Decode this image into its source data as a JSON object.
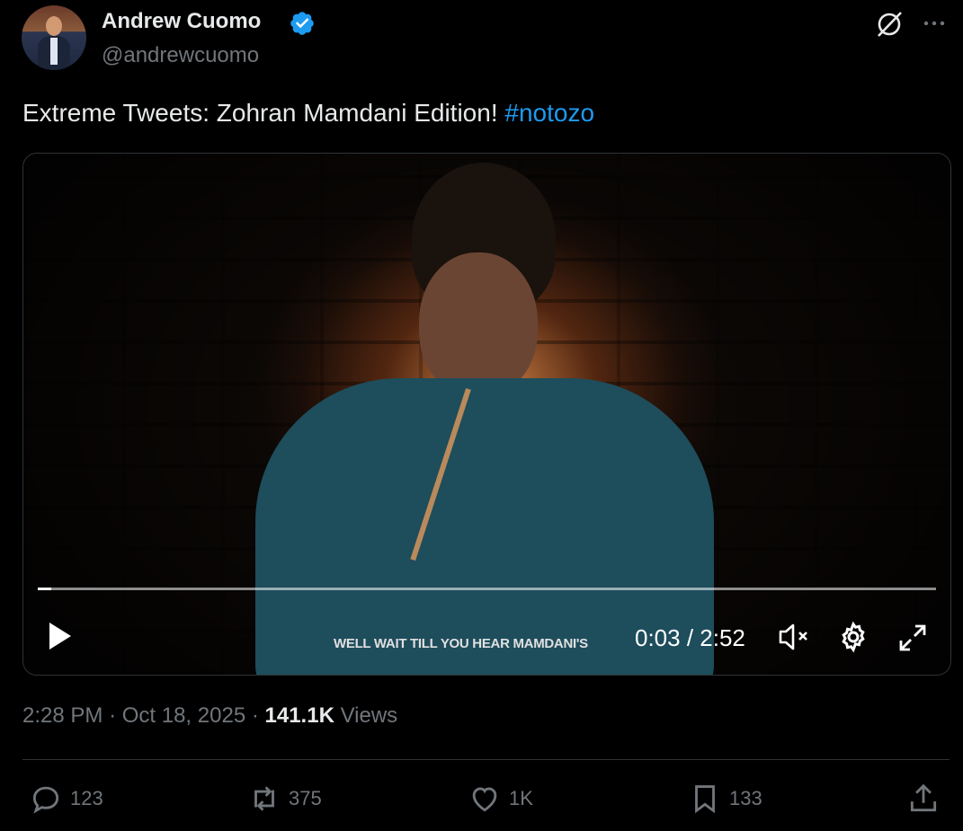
{
  "author": {
    "name": "Andrew Cuomo",
    "handle": "@andrewcuomo",
    "verified_icon": "verified-badge-icon"
  },
  "header_icons": [
    "grok-icon",
    "more-icon"
  ],
  "tweet": {
    "text": "Extreme Tweets: Zohran Mamdani Edition!",
    "hashtag": "#notozo"
  },
  "video": {
    "caption": "WELL WAIT TILL YOU HEAR MAMDANI'S",
    "time": "0:03 / 2:52",
    "progress_fraction": 0.015,
    "controls": [
      "play-icon",
      "mute-icon",
      "settings-icon",
      "fullscreen-icon"
    ]
  },
  "meta": {
    "time": "2:28 PM",
    "date": "Oct 18, 2025",
    "views_count": "141.1K",
    "views_label": "Views"
  },
  "actions": {
    "replies": "123",
    "reposts": "375",
    "likes": "1K",
    "bookmarks": "133"
  },
  "colors": {
    "accent": "#1d9bf0",
    "muted": "#71767b",
    "text": "#e7e9ea"
  }
}
